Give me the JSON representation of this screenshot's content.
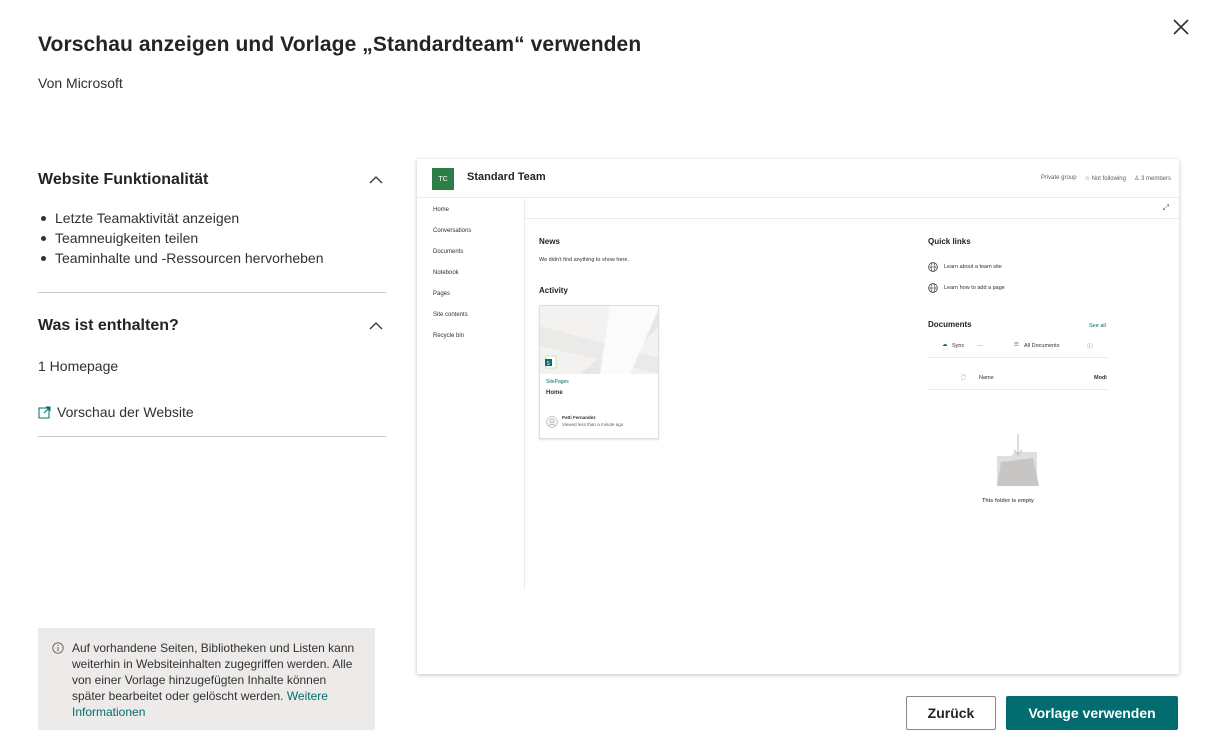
{
  "dialog": {
    "title": "Vorschau anzeigen und Vorlage „Standardteam“ verwenden",
    "subtitle": "Von Microsoft"
  },
  "sections": {
    "features": {
      "title": "Website Funktionalität",
      "items": [
        "Letzte Teamaktivität anzeigen",
        "Teamneuigkeiten teilen",
        "Teaminhalte und -Ressourcen hervorheben"
      ]
    },
    "contents": {
      "title": "Was ist enthalten?",
      "homepage_count": "1 Homepage",
      "preview_link": "Vorschau der Website"
    }
  },
  "info": {
    "text": "Auf vorhandene Seiten, Bibliotheken und Listen kann weiterhin in Websiteinhalten zugegriffen werden. Alle von einer Vorlage hinzugefügten Inhalte können später bearbeitet oder gelöscht werden.",
    "link": "Weitere Informationen"
  },
  "preview": {
    "logo_initials": "TC",
    "site_name": "Standard Team",
    "meta": [
      "Private group",
      "☆ Not following",
      "♙ 3 members"
    ],
    "nav": [
      "Home",
      "Conversations",
      "Documents",
      "Notebook",
      "Pages",
      "Site contents",
      "Recycle bin"
    ],
    "news_title": "News",
    "news_empty": "We didn't find anything to show here.",
    "activity_title": "Activity",
    "card_location": "SitePages",
    "card_title": "Home",
    "card_user": "Patti Fernandez",
    "card_viewed": "Viewed less than a minute ago",
    "quick_links_title": "Quick links",
    "quick_links": [
      "Learn about a team site",
      "Learn how to add a page"
    ],
    "documents_title": "Documents",
    "see_all": "See all",
    "sync_label": "Sync",
    "more_label": "···",
    "view_label": "All Documents",
    "col_name": "Name",
    "col_modified": "Modi",
    "empty_folder": "This folder is empty"
  },
  "buttons": {
    "back": "Zurück",
    "use_template": "Vorlage verwenden"
  },
  "colors": {
    "accent": "#036c70",
    "logo_bg": "#2d7d46"
  }
}
